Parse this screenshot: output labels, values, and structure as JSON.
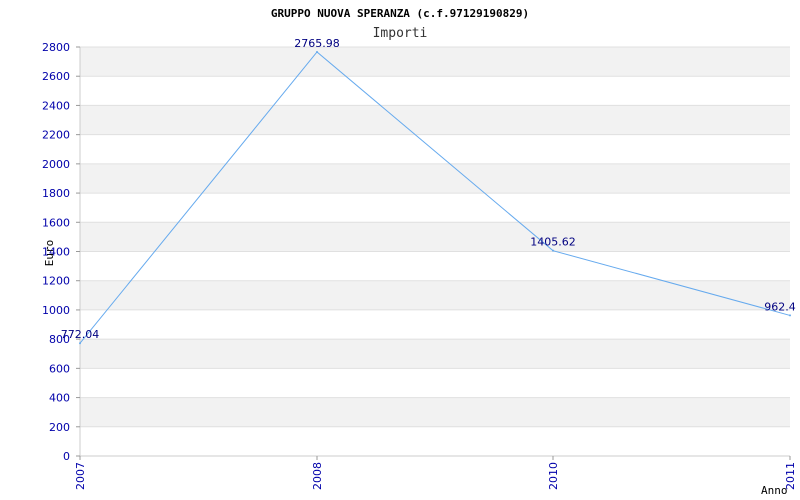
{
  "chart_data": {
    "type": "line",
    "title": "GRUPPO NUOVA SPERANZA (c.f.97129190829)",
    "subtitle": "Importi",
    "xlabel": "Anno",
    "ylabel": "Euro",
    "categories": [
      "2007",
      "2008",
      "2010",
      "2011"
    ],
    "series": [
      {
        "values": [
          772.04,
          2765.98,
          1405.62,
          962.4
        ]
      }
    ],
    "data_labels": [
      "772.04",
      "2765.98",
      "1405.62",
      "962.4"
    ],
    "ylim": [
      0,
      2800
    ],
    "yticks": [
      0,
      200,
      400,
      600,
      800,
      1000,
      1200,
      1400,
      1600,
      1800,
      2000,
      2200,
      2400,
      2600,
      2800
    ],
    "grid": true,
    "line_color": "#66aaee",
    "band_color": "#f2f2f2"
  }
}
